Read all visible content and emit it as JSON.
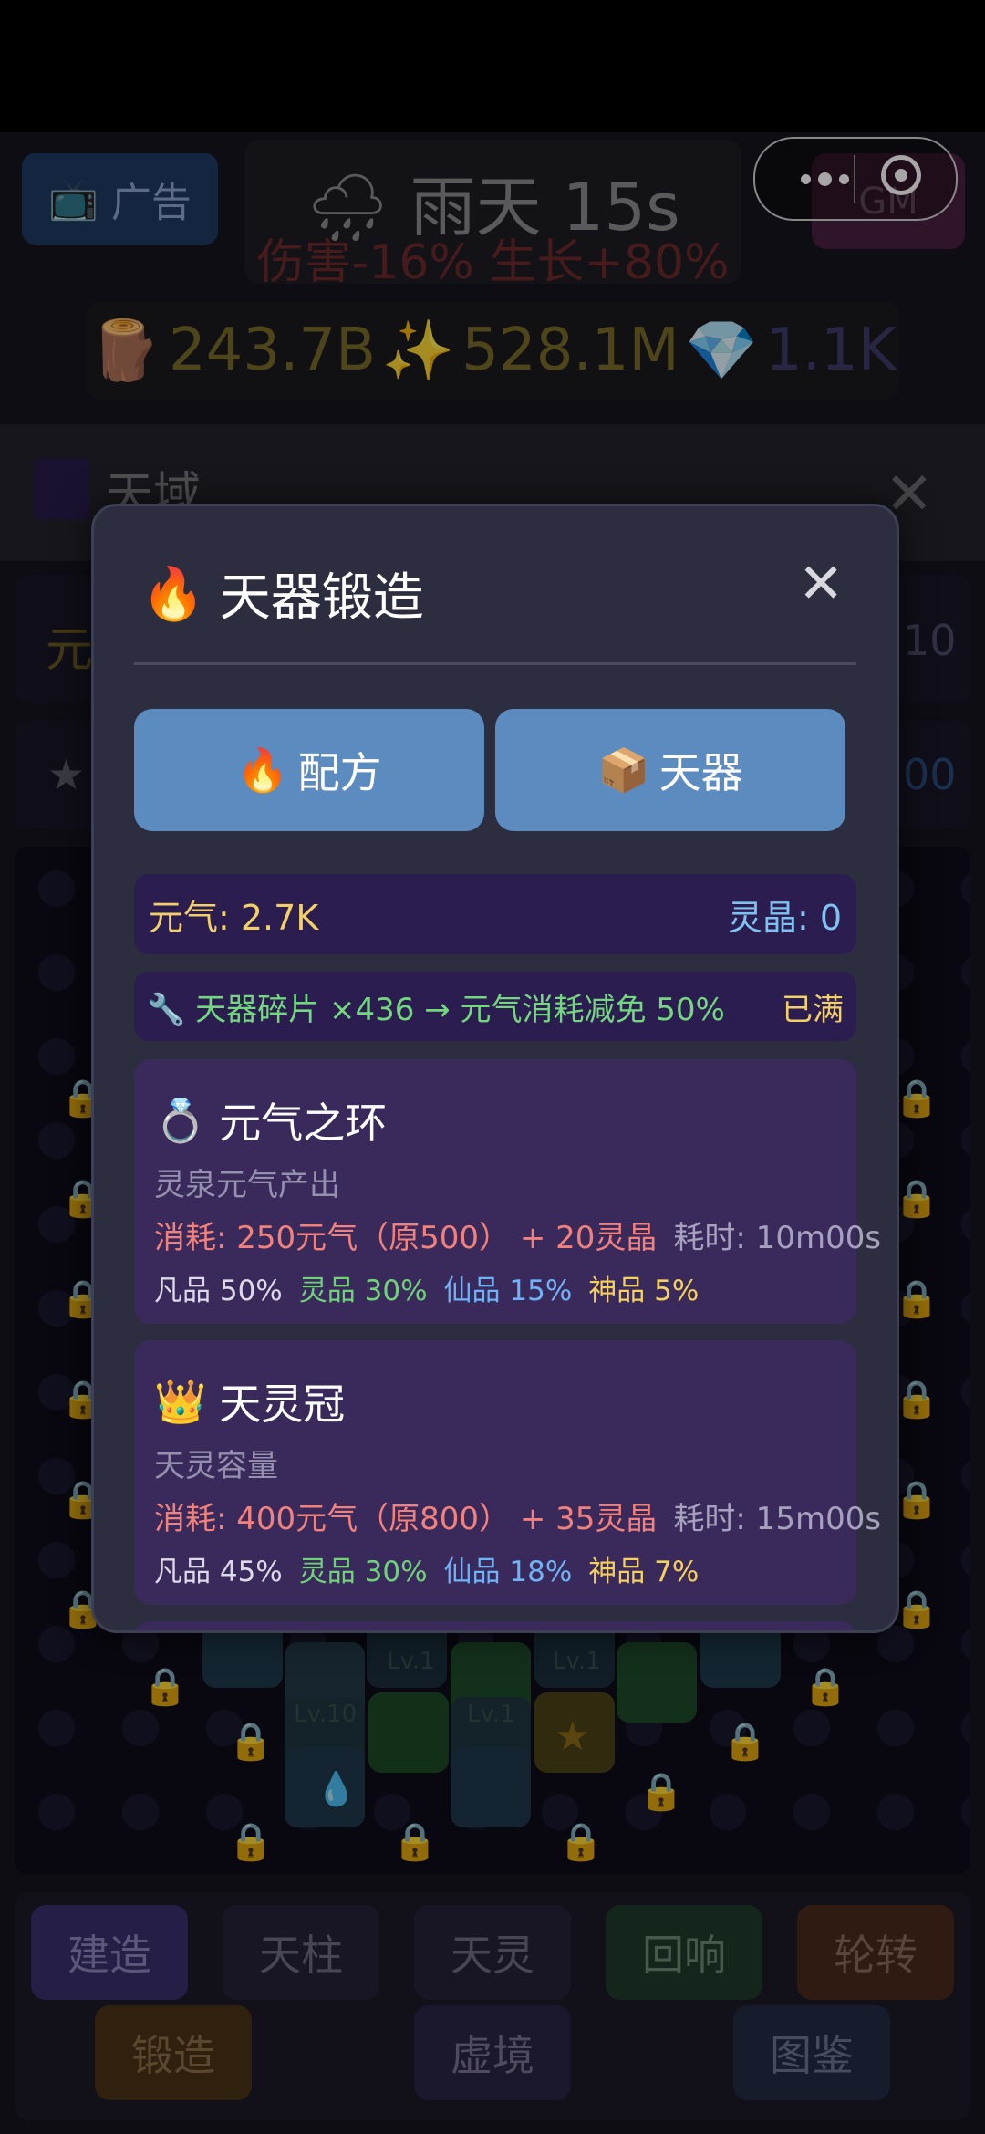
{
  "top": {
    "ad_label": "广告",
    "weather_title": "雨天 15s",
    "weather_effect": "伤害-16% 生长+80%",
    "gm_label": "GM",
    "resources": [
      {
        "icon": "wood-icon",
        "glyph": "🪵",
        "value": "243.7B"
      },
      {
        "icon": "sparkle-icon",
        "glyph": "✨",
        "value": "528.1M"
      },
      {
        "icon": "diamond-icon",
        "glyph": "💎",
        "value": "1.1K"
      }
    ]
  },
  "panel": {
    "title": "天域",
    "side_left_1": "元",
    "side_right_1": "10",
    "side_right_2": "00"
  },
  "modal": {
    "title": "天器锻造",
    "title_icon": "🔥",
    "tabs": [
      {
        "label": "配方",
        "glyph": "🔥",
        "icon": "fire-icon"
      },
      {
        "label": "天器",
        "glyph": "📦",
        "icon": "package-icon"
      }
    ],
    "yuanqi": "元气: 2.7K",
    "lingjing": "灵晶: 0",
    "bonus_text": "天器碎片 ×436 → 元气消耗减免 50%",
    "bonus_status": "已满",
    "recipes": [
      {
        "glyph": "💍",
        "name": "元气之环",
        "desc": "灵泉元气产出",
        "cost": "消耗: 250元气（原500） + 20灵晶",
        "time": "耗时: 10m00s",
        "rates": [
          "凡品 50%",
          "灵品 30%",
          "仙品 15%",
          "神品 5%"
        ]
      },
      {
        "glyph": "👑",
        "name": "天灵冠",
        "desc": "天灵容量",
        "cost": "消耗: 400元气（原800） + 35灵晶",
        "time": "耗时: 15m00s",
        "rates": [
          "凡品 45%",
          "灵品 30%",
          "仙品 18%",
          "神品 7%"
        ]
      }
    ]
  },
  "grid_labels": [
    "Lv.1",
    "Lv.1",
    "Lv.10",
    "Lv.1"
  ],
  "nav": {
    "row1": [
      "建造",
      "天柱",
      "天灵",
      "回响",
      "轮转"
    ],
    "row2": [
      "锻造",
      "虚境",
      "图鉴"
    ]
  }
}
